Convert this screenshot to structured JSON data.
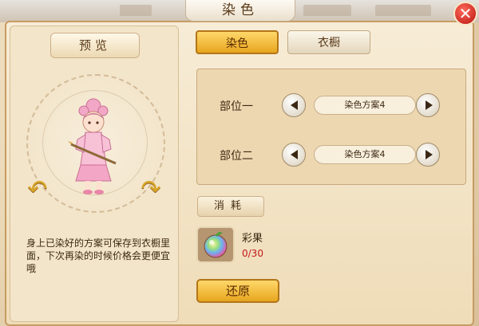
{
  "window": {
    "title": "染色",
    "close_glyph": "✕"
  },
  "preview": {
    "title": "预览",
    "description": "身上已染好的方案可保存到衣橱里面，下次再染的时候价格会更便宜哦"
  },
  "tabs": [
    {
      "label": "染色",
      "active": true
    },
    {
      "label": "衣橱",
      "active": false
    }
  ],
  "parts": [
    {
      "label": "部位一",
      "scheme": "染色方案4"
    },
    {
      "label": "部位二",
      "scheme": "染色方案4"
    }
  ],
  "cost": {
    "title": "消耗",
    "item_name": "彩果",
    "item_count": "0/30"
  },
  "actions": {
    "restore_label": "还原"
  },
  "colors": {
    "accent_gold": "#e7a51f",
    "count_red": "#c01818",
    "text_brown": "#5b3b1a"
  },
  "icons": {
    "close": "close-icon",
    "rotate_left": "rotate-left-icon",
    "rotate_right": "rotate-right-icon",
    "prev": "triangle-left-icon",
    "next": "triangle-right-icon",
    "item": "rainbow-fruit-icon"
  }
}
